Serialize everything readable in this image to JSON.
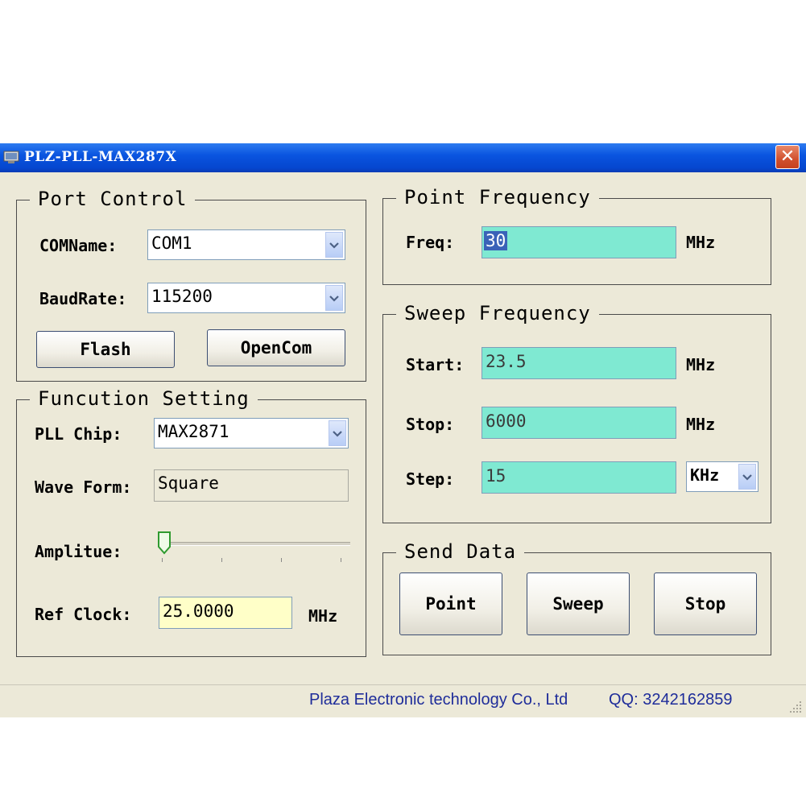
{
  "window": {
    "title": "PLZ-PLL-MAX287X",
    "close_label": "✕"
  },
  "port_control": {
    "legend": "Port Control",
    "comname_label": "COMName:",
    "comname_value": "COM1",
    "baudrate_label": "BaudRate:",
    "baudrate_value": "115200",
    "flash_label": "Flash",
    "opencom_label": "OpenCom"
  },
  "function_setting": {
    "legend": "Funcution Setting",
    "pll_chip_label": "PLL Chip:",
    "pll_chip_value": "MAX2871",
    "wave_form_label": "Wave Form:",
    "wave_form_value": "Square",
    "amplitude_label": "Amplitue:",
    "amplitude_level": 0,
    "ref_clock_label": "Ref Clock:",
    "ref_clock_value": "25.0000",
    "ref_clock_unit": "MHz"
  },
  "point_frequency": {
    "legend": "Point Frequency",
    "freq_label": "Freq:",
    "freq_value": "30",
    "freq_unit": "MHz"
  },
  "sweep_frequency": {
    "legend": "Sweep Frequency",
    "start_label": "Start:",
    "start_value": "23.5",
    "start_unit": "MHz",
    "stop_label": "Stop:",
    "stop_value": "6000",
    "stop_unit": "MHz",
    "step_label": "Step:",
    "step_value": "15",
    "step_unit": "KHz"
  },
  "send_data": {
    "legend": "Send Data",
    "point_label": "Point",
    "sweep_label": "Sweep",
    "stop_label": "Stop"
  },
  "status_bar": {
    "company": "Plaza Electronic technology Co., Ltd",
    "qq": "QQ: 3242162859"
  },
  "colors": {
    "title_bar": "#0a55e0",
    "field_bg": "#7fe9d2",
    "ref_clock_bg": "#ffffc8",
    "status_text": "#1f2d9a"
  }
}
